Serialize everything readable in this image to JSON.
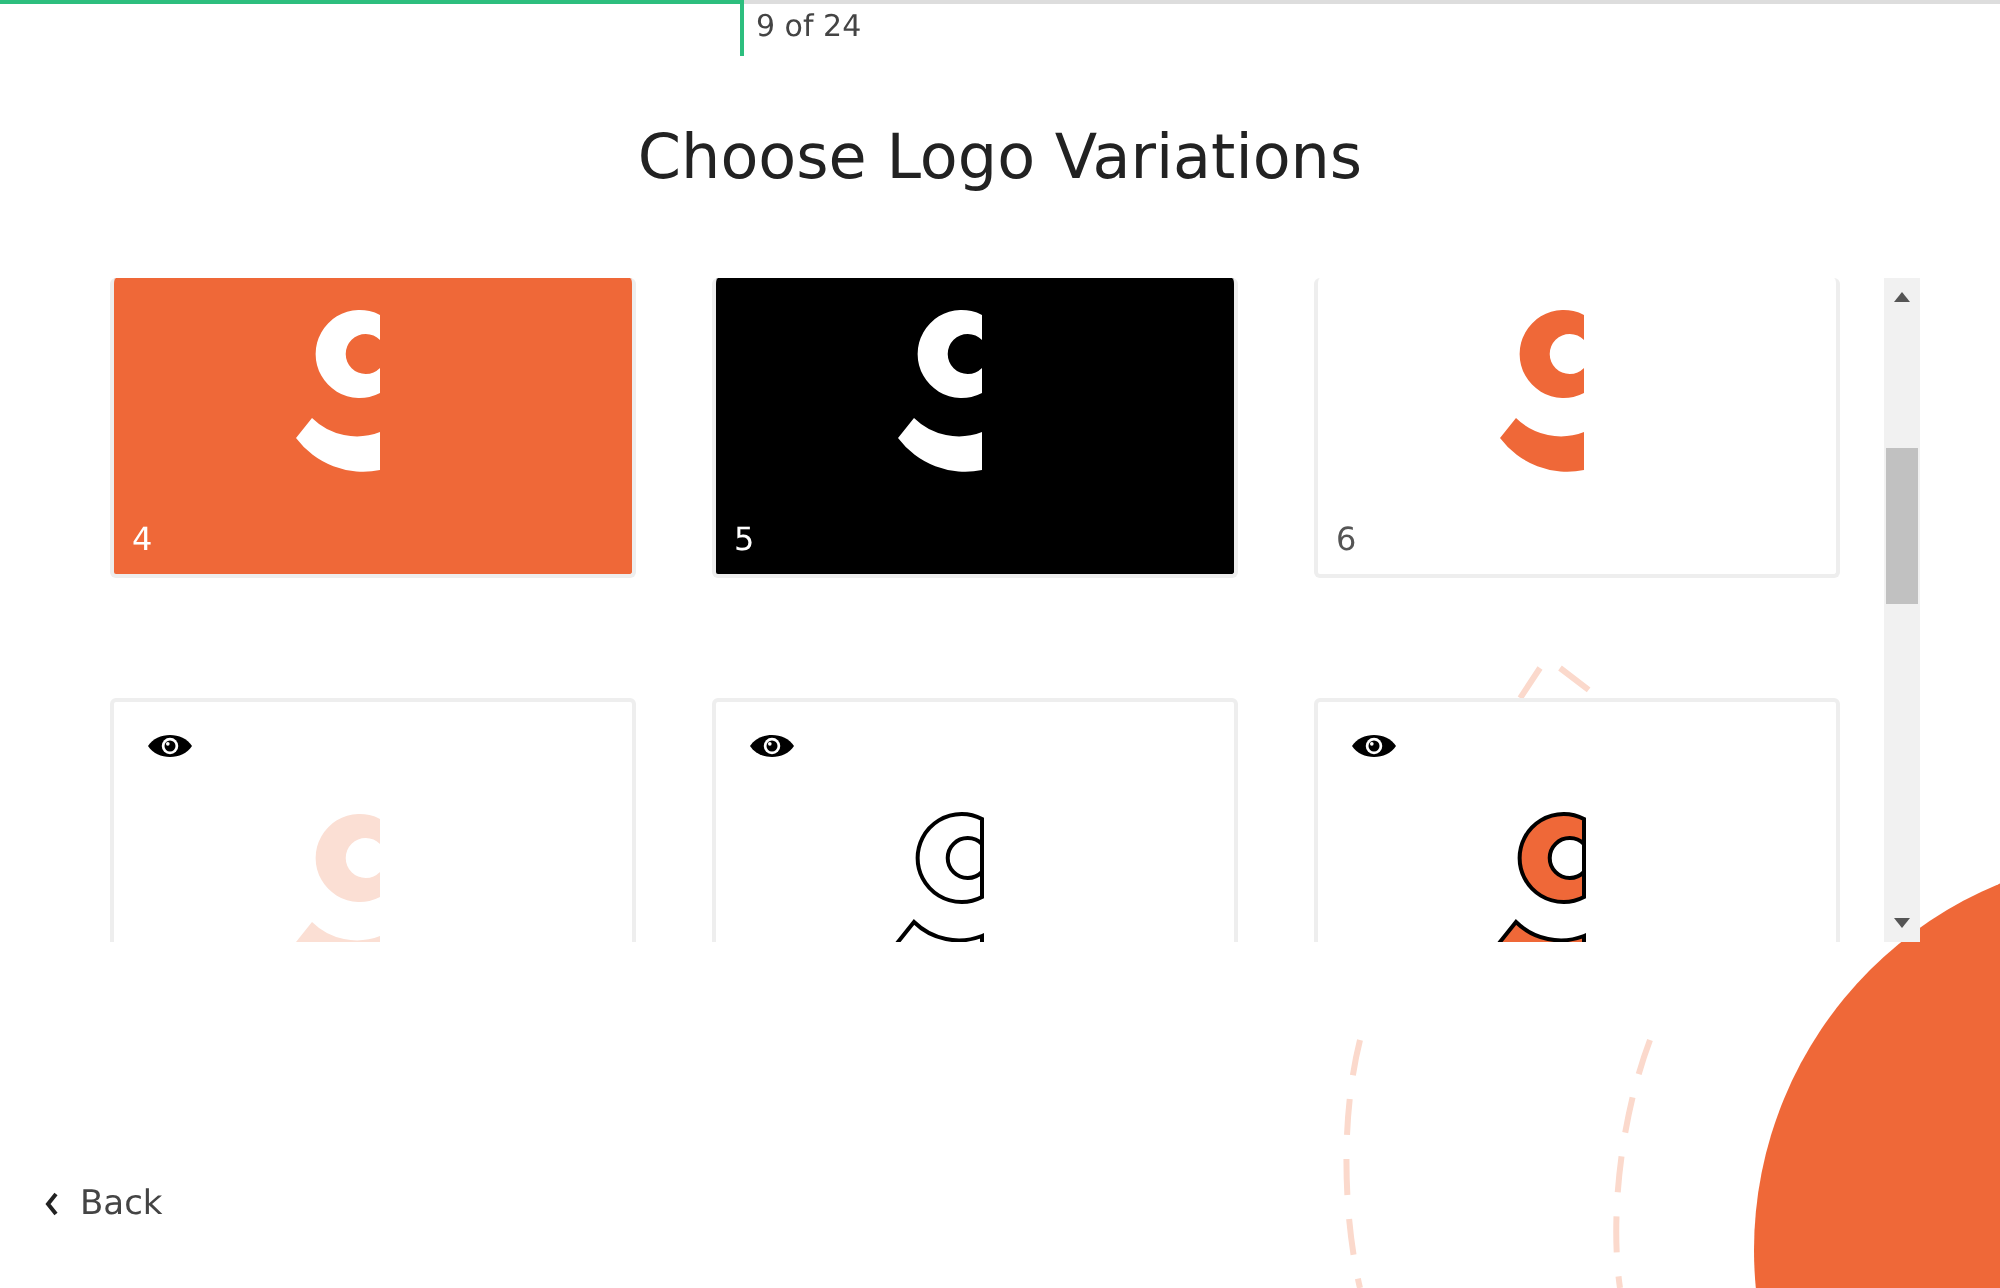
{
  "progress": {
    "level": 0.372,
    "label": "9 of 24"
  },
  "title": "Choose Logo Variations",
  "tiles": [
    {
      "label": "4",
      "kind": "orange-bg",
      "preview_icon": false
    },
    {
      "label": "5",
      "kind": "black-bg",
      "preview_icon": false
    },
    {
      "label": "6",
      "kind": "orange-logo",
      "preview_icon": false
    },
    {
      "kind": "pale-logo",
      "preview_icon": true
    },
    {
      "kind": "outline-logo",
      "preview_icon": true
    },
    {
      "kind": "outlined-orange-logo",
      "preview_icon": true
    }
  ],
  "back": {
    "label": "Back"
  }
}
